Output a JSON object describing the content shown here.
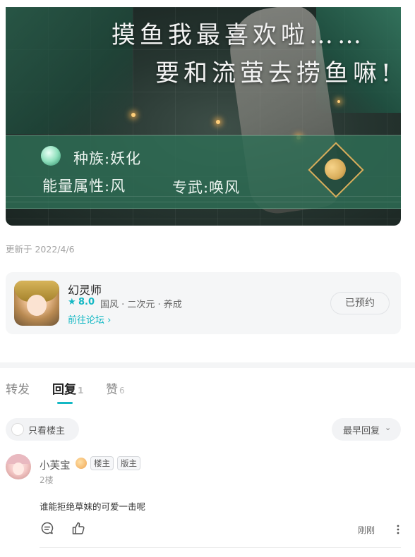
{
  "banner": {
    "line1": "摸鱼我最喜欢啦……",
    "line2": "要和流萤去捞鱼嘛!",
    "race": "种族:妖化",
    "attribute": "能量属性:风",
    "weapon": "专武:唤风"
  },
  "post": {
    "updated_text": "更新于 2022/4/6"
  },
  "game": {
    "name": "幻灵师",
    "star_icon": "★",
    "score": "8.0",
    "tags": "国风 · 二次元 · 养成",
    "forum_link": "前往论坛 ›",
    "reserve_label": "已预约"
  },
  "tabs": {
    "repost": {
      "label": "转发"
    },
    "reply": {
      "label": "回复",
      "count": "1"
    },
    "like": {
      "label": "赞",
      "count": "6"
    }
  },
  "filters": {
    "only_owner_label": "只看楼主",
    "sort_label": "最早回复",
    "sort_chevron": "⌄"
  },
  "comment": {
    "author": "小芙宝",
    "tag_owner": "楼主",
    "tag_moderator": "版主",
    "floor": "2楼",
    "text": "谁能拒绝草妹的可爱一击呢",
    "time": "刚刚"
  },
  "colors": {
    "accent": "#14b8c4",
    "banner_bar": "#2e6e56",
    "emblem_gold": "#d9ae5c"
  },
  "icons": [
    "reply-icon",
    "like-icon",
    "more-icon",
    "star-icon",
    "chevron-down-icon",
    "radio-icon"
  ]
}
